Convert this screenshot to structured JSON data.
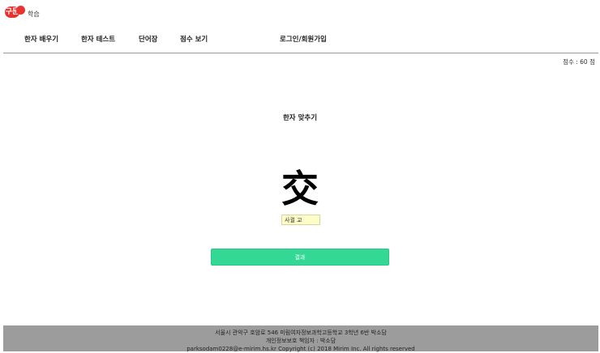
{
  "logo": {
    "badge_text": "구문",
    "text": "학습"
  },
  "nav": {
    "items": [
      "한자 배우기",
      "한자 테스트",
      "단어장",
      "점수 보기"
    ],
    "login_label": "로그인/회원가입"
  },
  "score_text": "점수 : 60 점",
  "quiz": {
    "title": "한자 맞추기",
    "character": "交",
    "answer_value": "사귈 교",
    "submit_label": "결과"
  },
  "footer": {
    "line1": "서울시 관악구 호암로 546 미림여자정보과학고등학교 3학년 6반 박소담",
    "line2": "개인정보보호 책임자 : 박소담",
    "line3": "parksodam0228@e-mirim.hs.kr Copyright (c) 2018 Mirim Inc. All rights reserved"
  },
  "colors": {
    "accent": "#33d895",
    "logo": "#e8322f",
    "footer_bg": "#9c9c9c"
  }
}
